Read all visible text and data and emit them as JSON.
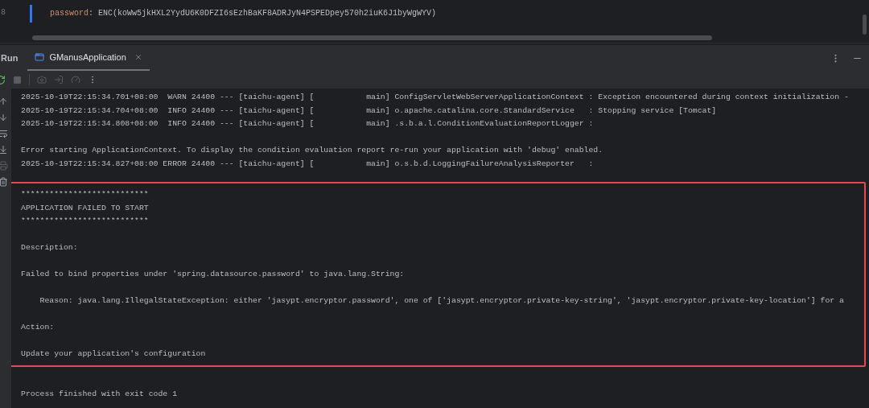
{
  "editor": {
    "line_number": "8",
    "key": "password",
    "separator": ":",
    "value": "ENC(koWw5jkHXL2YydU6K0DFZI6sEzhBaKF8ADRJyN4PSPEDpey570h2iuK6J1byWgWYV)"
  },
  "run_panel": {
    "title": "Run",
    "tabs": [
      {
        "label": "GManusApplication",
        "selected": true
      }
    ]
  },
  "console": {
    "log_blocks": [
      [
        "2025-10-19T22:15:34.701+08:00  WARN 24400 --- [taichu-agent] [           main] ConfigServletWebServerApplicationContext : Exception encountered during context initialization -",
        "2025-10-19T22:15:34.704+08:00  INFO 24400 --- [taichu-agent] [           main] o.apache.catalina.core.StandardService   : Stopping service [Tomcat]",
        "2025-10-19T22:15:34.808+08:00  INFO 24400 --- [taichu-agent] [           main] .s.b.a.l.ConditionEvaluationReportLogger :"
      ],
      [
        "Error starting ApplicationContext. To display the condition evaluation report re-run your application with 'debug' enabled.",
        "2025-10-19T22:15:34.827+08:00 ERROR 24400 --- [taichu-agent] [           main] o.s.b.d.LoggingFailureAnalysisReporter   :"
      ]
    ],
    "highlighted_blocks": [
      [
        "***************************",
        "APPLICATION FAILED TO START",
        "***************************"
      ],
      [
        "Description:"
      ],
      [
        "Failed to bind properties under 'spring.datasource.password' to java.lang.String:"
      ],
      [
        "    Reason: java.lang.IllegalStateException: either 'jasypt.encryptor.password', one of ['jasypt.encryptor.private-key-string', 'jasypt.encryptor.private-key-location'] for a"
      ],
      [
        "Action:"
      ],
      [
        "Update your application's configuration"
      ]
    ],
    "exit_message": "Process finished with exit code 1"
  }
}
